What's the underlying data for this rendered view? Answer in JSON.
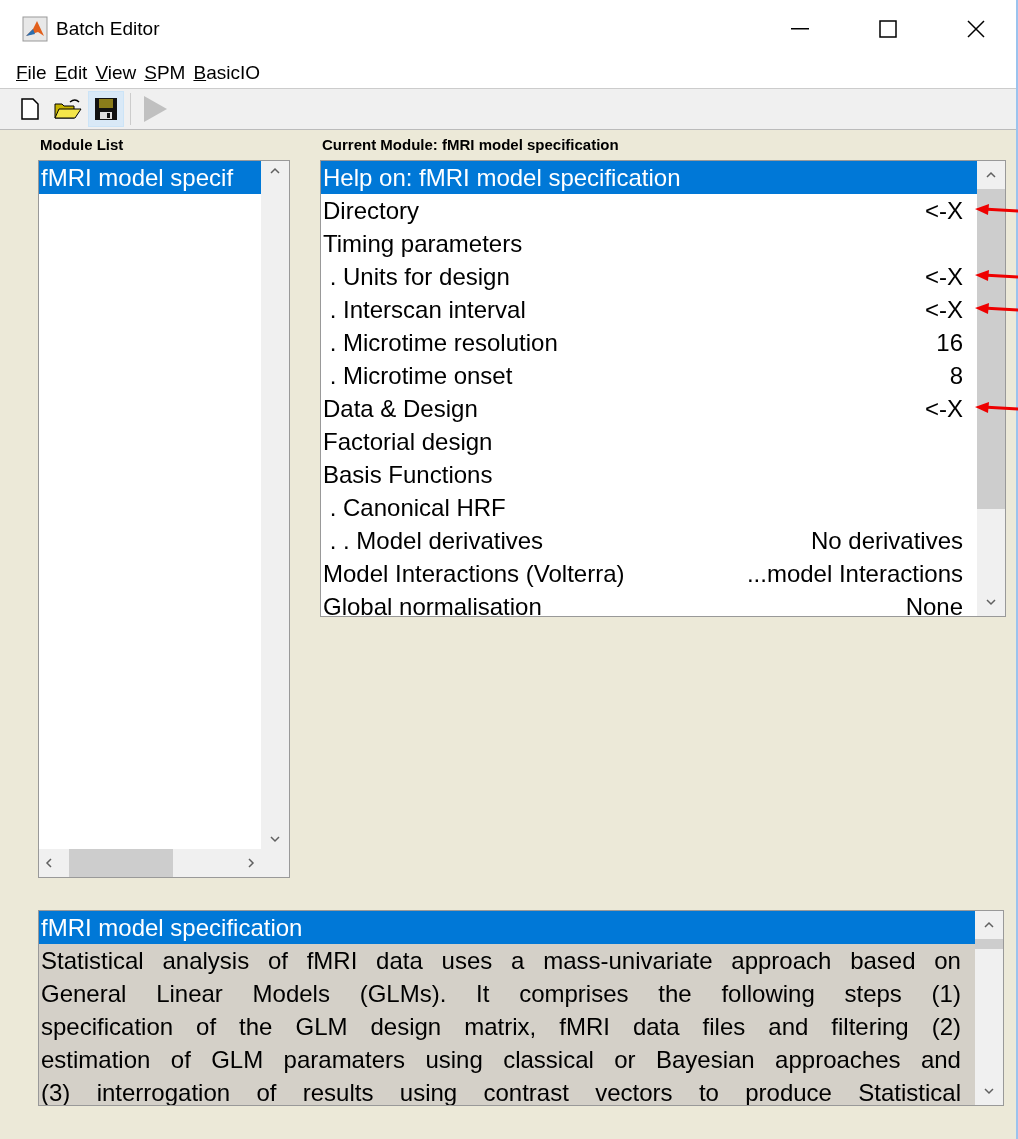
{
  "window": {
    "title": "Batch Editor"
  },
  "menu": [
    "File",
    "Edit",
    "View",
    "SPM",
    "BasicIO"
  ],
  "toolbar": [
    {
      "kind": "new",
      "highlighted": false,
      "disabled": false
    },
    {
      "kind": "open",
      "highlighted": false,
      "disabled": false
    },
    {
      "kind": "save",
      "highlighted": true,
      "disabled": false
    },
    {
      "kind": "run",
      "highlighted": false,
      "disabled": true
    }
  ],
  "module_list": {
    "title": "Module List",
    "items": [
      {
        "label": "fMRI model specif",
        "selected": true
      }
    ]
  },
  "current_module": {
    "title": "Current Module: fMRI model specification",
    "rows": [
      {
        "label": "Help on: fMRI model specification",
        "selected": true,
        "annotated": false
      },
      {
        "label": "Directory",
        "value": "<-X",
        "selected": false,
        "annotated": true
      },
      {
        "label": "Timing parameters",
        "selected": false,
        "annotated": false
      },
      {
        "label": " . Units for design",
        "value": "<-X",
        "selected": false,
        "annotated": true
      },
      {
        "label": " . Interscan interval",
        "value": "<-X",
        "selected": false,
        "annotated": true
      },
      {
        "label": " . Microtime resolution",
        "value": "16",
        "selected": false,
        "annotated": false
      },
      {
        "label": " . Microtime onset",
        "value": "8",
        "selected": false,
        "annotated": false
      },
      {
        "label": "Data & Design",
        "value": "<-X",
        "selected": false,
        "annotated": true
      },
      {
        "label": "Factorial design",
        "selected": false,
        "annotated": false
      },
      {
        "label": "Basis Functions",
        "selected": false,
        "annotated": false
      },
      {
        "label": " . Canonical HRF",
        "selected": false,
        "annotated": false
      },
      {
        "label": " . . Model derivatives",
        "value": "No derivatives",
        "selected": false,
        "annotated": false
      },
      {
        "label": "Model Interactions (Volterra)",
        "value": "...model Interactions",
        "selected": false,
        "annotated": false
      },
      {
        "label": "Global normalisation",
        "value": "None",
        "selected": false,
        "annotated": false
      }
    ]
  },
  "help": {
    "title": "fMRI model specification",
    "lines": [
      "Statistical analysis of fMRI data uses a mass-univariate approach based on",
      "General Linear Models (GLMs). It comprises the following steps (1)",
      "specification of the GLM design matrix, fMRI data files and filtering (2)",
      "estimation of GLM paramaters using classical or Bayesian approaches and",
      "(3) interrogation of results using contrast vectors to produce Statistical"
    ]
  }
}
